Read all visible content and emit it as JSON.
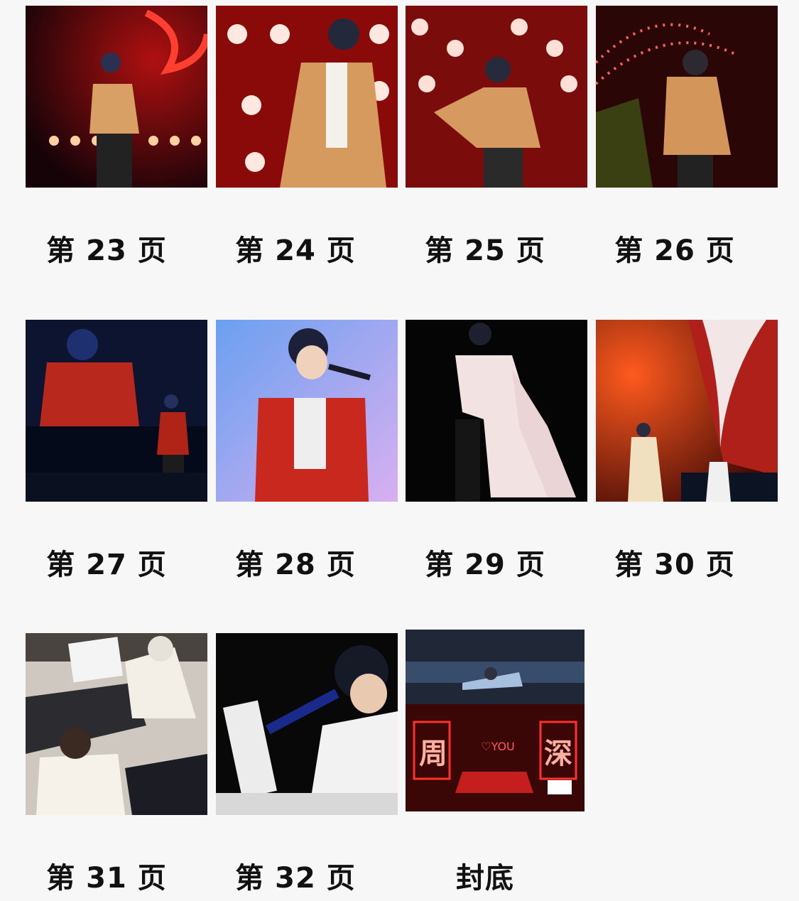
{
  "pages": [
    {
      "label": "第 23 页"
    },
    {
      "label": "第 24 页"
    },
    {
      "label": "第 25 页"
    },
    {
      "label": "第 26 页"
    },
    {
      "label": "第 27 页"
    },
    {
      "label": "第 28 页"
    },
    {
      "label": "第 29 页"
    },
    {
      "label": "第 30 页"
    },
    {
      "label": "第 31 页"
    },
    {
      "label": "第 32 页"
    },
    {
      "label": "封底"
    }
  ],
  "cover_back_sign": {
    "left_char": "周",
    "right_char": "深",
    "heart_text": "♡YOU"
  }
}
